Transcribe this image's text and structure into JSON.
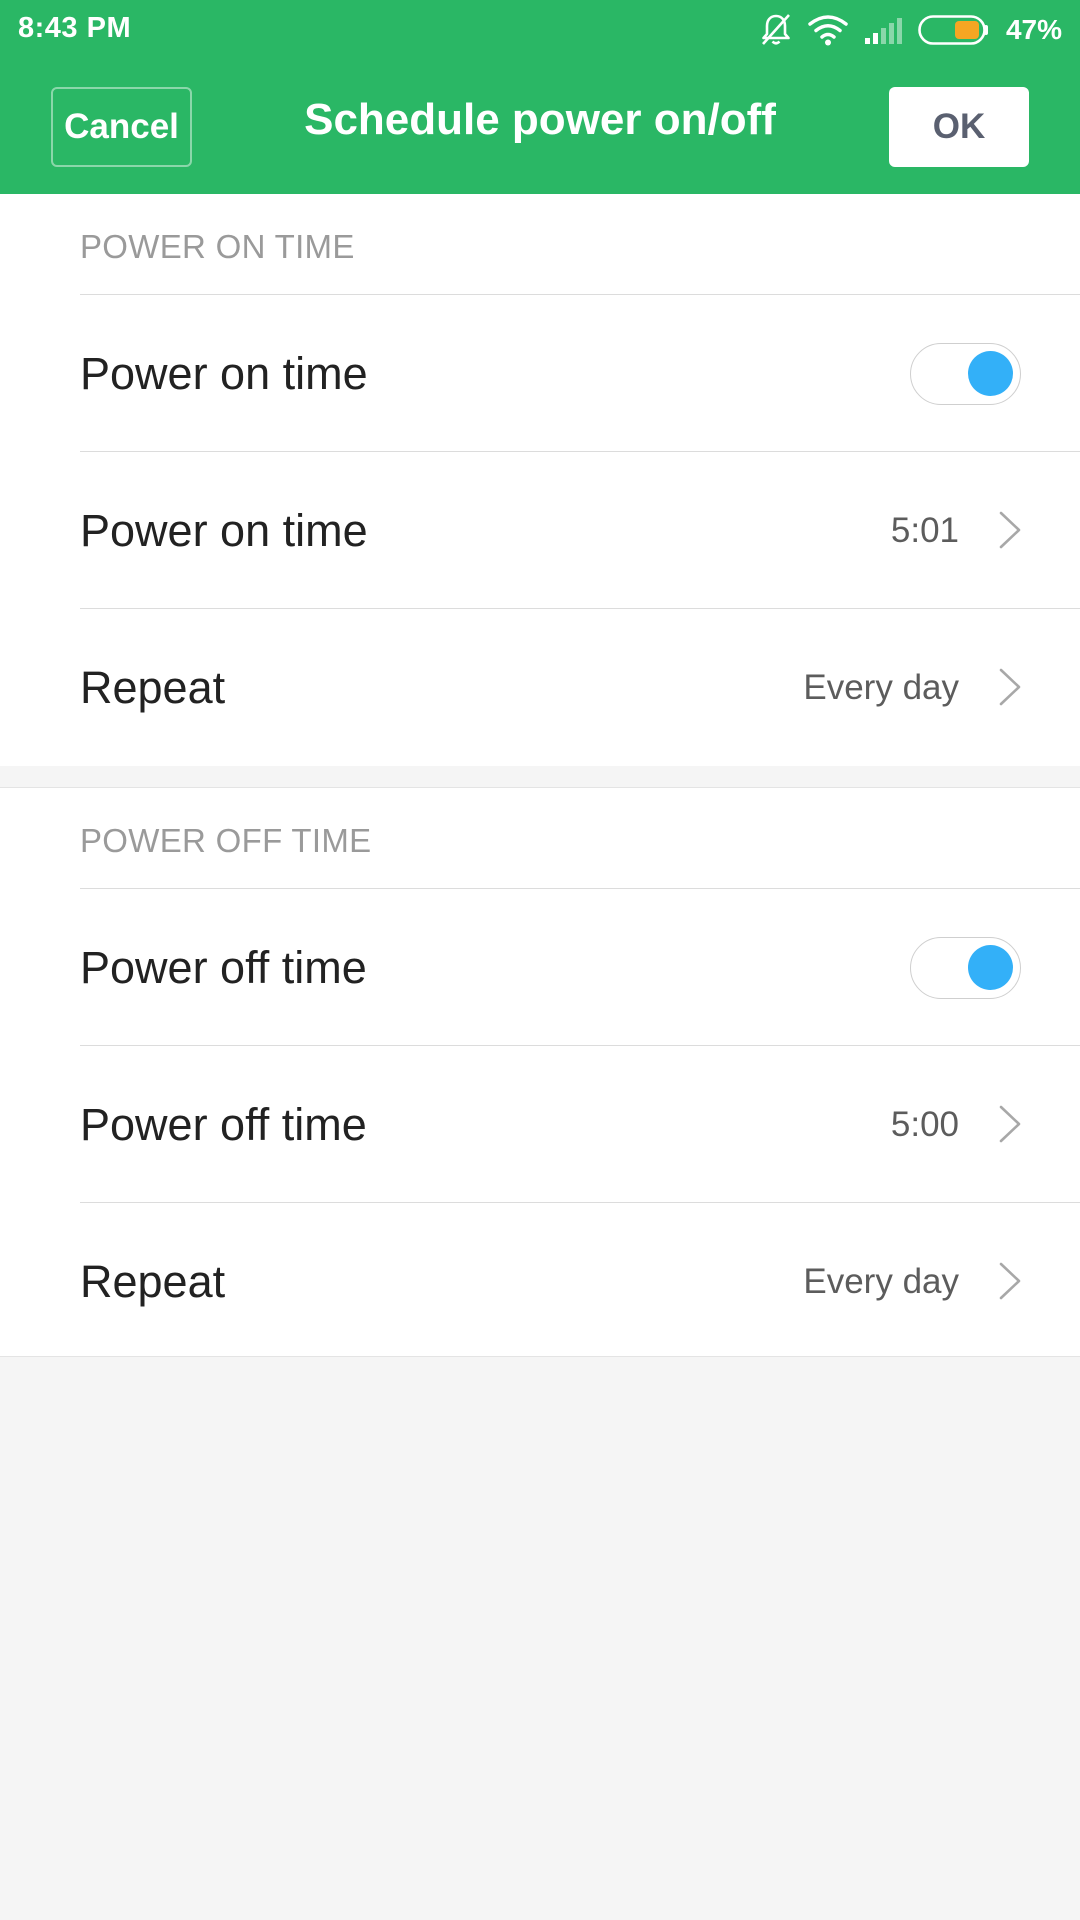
{
  "status_bar": {
    "time": "8:43 PM",
    "battery_percent": "47%",
    "icons": [
      "notifications-off-icon",
      "wifi-icon",
      "signal-icon",
      "battery-icon"
    ]
  },
  "header": {
    "cancel_label": "Cancel",
    "title": "Schedule power on/off",
    "ok_label": "OK"
  },
  "power_on": {
    "section_title": "POWER ON TIME",
    "toggle_label": "Power on time",
    "toggle_on": true,
    "time_label": "Power on time",
    "time_value": "5:01",
    "repeat_label": "Repeat",
    "repeat_value": "Every day"
  },
  "power_off": {
    "section_title": "POWER OFF TIME",
    "toggle_label": "Power off time",
    "toggle_on": true,
    "time_label": "Power off time",
    "time_value": "5:00",
    "repeat_label": "Repeat",
    "repeat_value": "Every day"
  },
  "colors": {
    "header_green": "#2ab765",
    "toggle_blue": "#33b0f8",
    "battery_orange": "#f5a623"
  }
}
